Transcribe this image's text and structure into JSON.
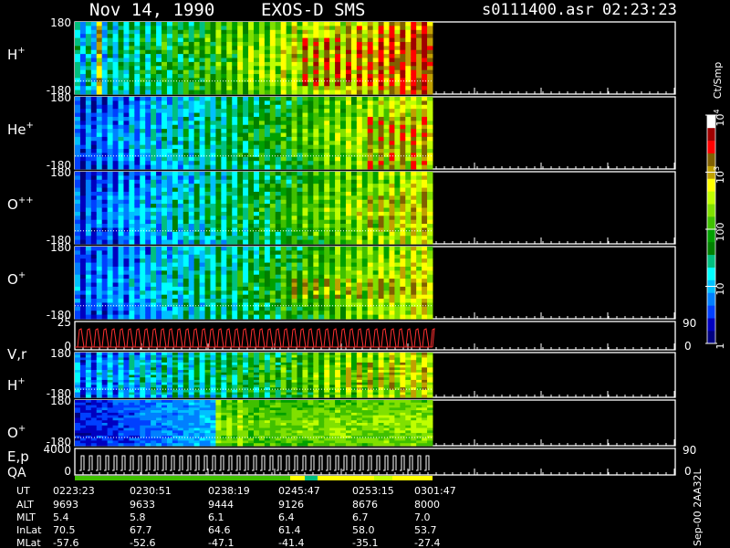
{
  "header": {
    "date": "Nov 14, 1990",
    "mission": "EXOS-D SMS",
    "file": "s0111400.asr",
    "time": "02:23:23"
  },
  "colorbar": {
    "title": "Ct/Smp",
    "ticks": [
      {
        "label": "1",
        "value": 1
      },
      {
        "label": "10",
        "value": 10
      },
      {
        "label": "100",
        "value": 100
      },
      {
        "label": "10",
        "sup": "3",
        "value": 1000
      },
      {
        "label": "10",
        "sup": "4",
        "value": 10000
      }
    ],
    "colors": [
      "#000080",
      "#0000c0",
      "#0040ff",
      "#0080ff",
      "#00c0ff",
      "#00ffff",
      "#00c080",
      "#008000",
      "#00a000",
      "#40c000",
      "#80e000",
      "#c0ff00",
      "#ffff00",
      "#c0a000",
      "#806000",
      "#ff0000",
      "#a00000",
      "#ffffff"
    ]
  },
  "footer": {
    "right_label": "Sep-00 2AA32L",
    "row_labels": [
      "UT",
      "ALT",
      "MLT",
      "InLat",
      "MLat"
    ],
    "columns": [
      [
        "0223:23",
        "9693",
        "5.4",
        "70.5",
        "-57.6"
      ],
      [
        "0230:51",
        "9633",
        "5.8",
        "67.7",
        "-52.6"
      ],
      [
        "0238:19",
        "9444",
        "6.1",
        "64.6",
        "-47.1"
      ],
      [
        "0245:47",
        "9126",
        "6.4",
        "61.4",
        "-41.4"
      ],
      [
        "0253:15",
        "8676",
        "6.7",
        "58.0",
        "-35.1"
      ],
      [
        "0301:47",
        "8000",
        "7.0",
        "53.7",
        "-27.4"
      ]
    ]
  },
  "chart_data": {
    "type": "heatmap",
    "x_ticks": [
      "0223:23",
      "0230:51",
      "0238:19",
      "0245:47",
      "0253:15",
      "0301:47"
    ],
    "panels": [
      {
        "ion": "H",
        "charge": "+",
        "ylabel_top": "180",
        "ylabel_bottom": "-180",
        "kind": "spectrogram",
        "profile": "h1"
      },
      {
        "ion": "He",
        "charge": "+",
        "ylabel_top": "180",
        "ylabel_bottom": "-180",
        "kind": "spectrogram",
        "profile": "he"
      },
      {
        "ion": "O",
        "charge": "++",
        "ylabel_top": "180",
        "ylabel_bottom": "-180",
        "kind": "spectrogram",
        "profile": "opp"
      },
      {
        "ion": "O",
        "charge": "+",
        "ylabel_top": "180",
        "ylabel_bottom": "-180",
        "kind": "spectrogram",
        "profile": "op"
      },
      {
        "ion": "V,r",
        "ylabel_top": "25",
        "ylabel_bottom": "0",
        "right_top": "90",
        "right_bottom": "0",
        "kind": "line"
      },
      {
        "ion": "H",
        "charge": "+",
        "ylabel_top": "180",
        "ylabel_bottom": "-180",
        "kind": "spectrogram",
        "profile": "h2"
      },
      {
        "ion": "O",
        "charge": "+",
        "ylabel_top": "180",
        "ylabel_bottom": "-180",
        "kind": "spectrogram",
        "profile": "op2"
      },
      {
        "ion": "E,p",
        "ion2": "QA",
        "ylabel_top": "4000",
        "ylabel_bottom": "0",
        "right_top": "90",
        "right_bottom": "0",
        "kind": "step"
      }
    ]
  }
}
